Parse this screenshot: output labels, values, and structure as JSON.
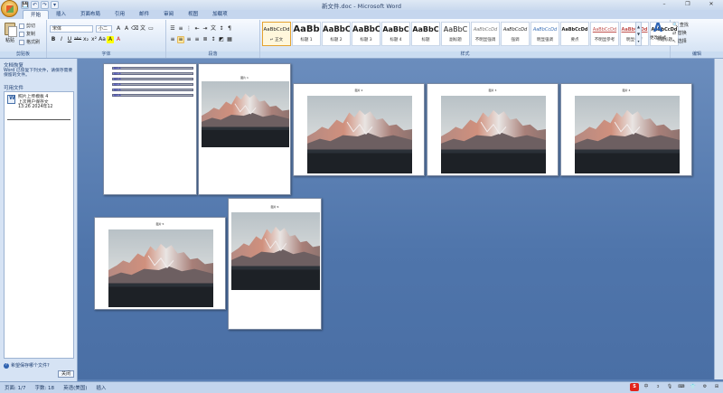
{
  "window": {
    "title": "新文件.doc - Microsoft Word",
    "min": "–",
    "max": "❐",
    "close": "✕"
  },
  "qat": [
    "💾",
    "↶",
    "↷",
    "▾"
  ],
  "tabs": [
    "开始",
    "插入",
    "页面布局",
    "引用",
    "邮件",
    "审阅",
    "视图",
    "加载项"
  ],
  "ribbon": {
    "clipboard": {
      "paste": "粘贴",
      "cut": "剪切",
      "copy": "复制",
      "format_painter": "格式刷",
      "label": "剪贴板"
    },
    "font": {
      "name": "宋体",
      "size": "小二",
      "label": "字体",
      "buttons": [
        "B",
        "I",
        "U",
        "abc",
        "x₂",
        "x²",
        "Aa",
        "A",
        "A"
      ]
    },
    "paragraph": {
      "label": "段落"
    },
    "styles": {
      "label": "样式",
      "items": [
        {
          "sample": "AaBbCcDd",
          "name": "↵ 正文"
        },
        {
          "sample": "AaBb",
          "name": "标题 1"
        },
        {
          "sample": "AaBbC",
          "name": "标题 2"
        },
        {
          "sample": "AaBbC",
          "name": "标题 3"
        },
        {
          "sample": "AaBbC",
          "name": "标题 4"
        },
        {
          "sample": "AaBbC",
          "name": "标题"
        },
        {
          "sample": "AaBbC",
          "name": "副标题"
        },
        {
          "sample": "AaBbCcDd",
          "name": "不明显强调"
        },
        {
          "sample": "AaBbCcDd",
          "name": "强调"
        },
        {
          "sample": "AaBbCcDd",
          "name": "明显强调"
        },
        {
          "sample": "AaBbCcDd",
          "name": "要点"
        },
        {
          "sample": "AaBbCcDd",
          "name": "不明显参考"
        },
        {
          "sample": "AaBbCcDd",
          "name": "明显参考"
        },
        {
          "sample": "AaBbCcDd",
          "name": "书籍标题"
        }
      ],
      "change_styles": "更改样式"
    },
    "editing": {
      "find": "查找",
      "replace": "替换",
      "select": "选择",
      "label": "编辑"
    }
  },
  "recovery_pane": {
    "heading": "文档恢复",
    "message": "Word 已恢复下列文件，请保存需要保留的文件。",
    "list_heading": "可用文件",
    "item": {
      "title": "照片上传模板 4",
      "desc": "上次用户保存文",
      "time": "13:26 2024年12"
    },
    "help": "希望保存哪个文件?",
    "close": "关闭"
  },
  "pages": [
    {
      "caption": ""
    },
    {
      "caption": "图片 1"
    },
    {
      "caption": "图片 2"
    },
    {
      "caption": "图片 3"
    },
    {
      "caption": "图片 4"
    },
    {
      "caption": "图片 5"
    },
    {
      "caption": "图片 6"
    }
  ],
  "toc_items": [
    "图片 1",
    "图片 2",
    "图片 3",
    "图片 4",
    "图片 5",
    "图片 6"
  ],
  "status": {
    "page": "页面: 1/7",
    "words": "字数: 18",
    "lang": "英语(美国)",
    "mode": "插入",
    "tray": [
      "中",
      "ↄ",
      "🎙",
      "⌨",
      "👕",
      "⚙",
      "⊞"
    ]
  }
}
